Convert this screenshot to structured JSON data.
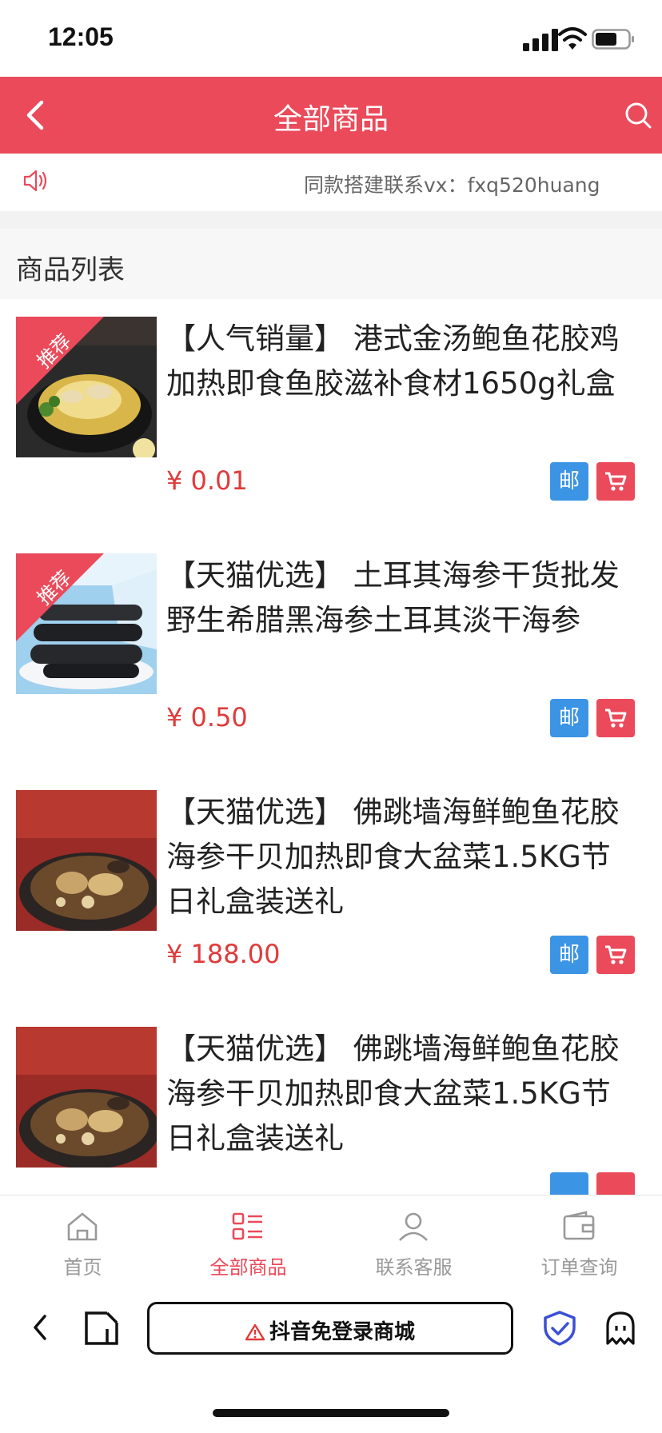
{
  "status_bar": {
    "time": "12:05"
  },
  "header": {
    "title": "全部商品"
  },
  "notice": {
    "text": "同款搭建联系vx：fxq520huang"
  },
  "section": {
    "title": "商品列表"
  },
  "products": [
    {
      "name": "【人气销量】 港式金汤鲍鱼花胶鸡加热即食鱼胶滋补食材1650g礼盒",
      "price": "¥ 0.01",
      "badge": "推荐",
      "mail_label": "邮"
    },
    {
      "name": "【天猫优选】 土耳其海参干货批发 野生希腊黑海参土耳其淡干海参",
      "price": "¥ 0.50",
      "badge": "推荐",
      "mail_label": "邮"
    },
    {
      "name": "【天猫优选】 佛跳墙海鲜鲍鱼花胶海参干贝加热即食大盆菜1.5KG节日礼盒装送礼",
      "price": "¥ 188.00",
      "badge": "",
      "mail_label": "邮"
    },
    {
      "name": "【天猫优选】 佛跳墙海鲜鲍鱼花胶海参干贝加热即食大盆菜1.5KG节日礼盒装送礼",
      "price": "",
      "badge": "",
      "mail_label": ""
    }
  ],
  "tabbar": [
    {
      "label": "首页",
      "icon": "home-icon",
      "active": false
    },
    {
      "label": "全部商品",
      "icon": "list-icon",
      "active": true
    },
    {
      "label": "联系客服",
      "icon": "user-icon",
      "active": false
    },
    {
      "label": "订单查询",
      "icon": "wallet-icon",
      "active": false
    }
  ],
  "browser": {
    "address": "抖音免登录商城"
  },
  "colors": {
    "accent": "#ea4a5a",
    "price": "#e03a3a",
    "mail": "#3b94e4"
  }
}
